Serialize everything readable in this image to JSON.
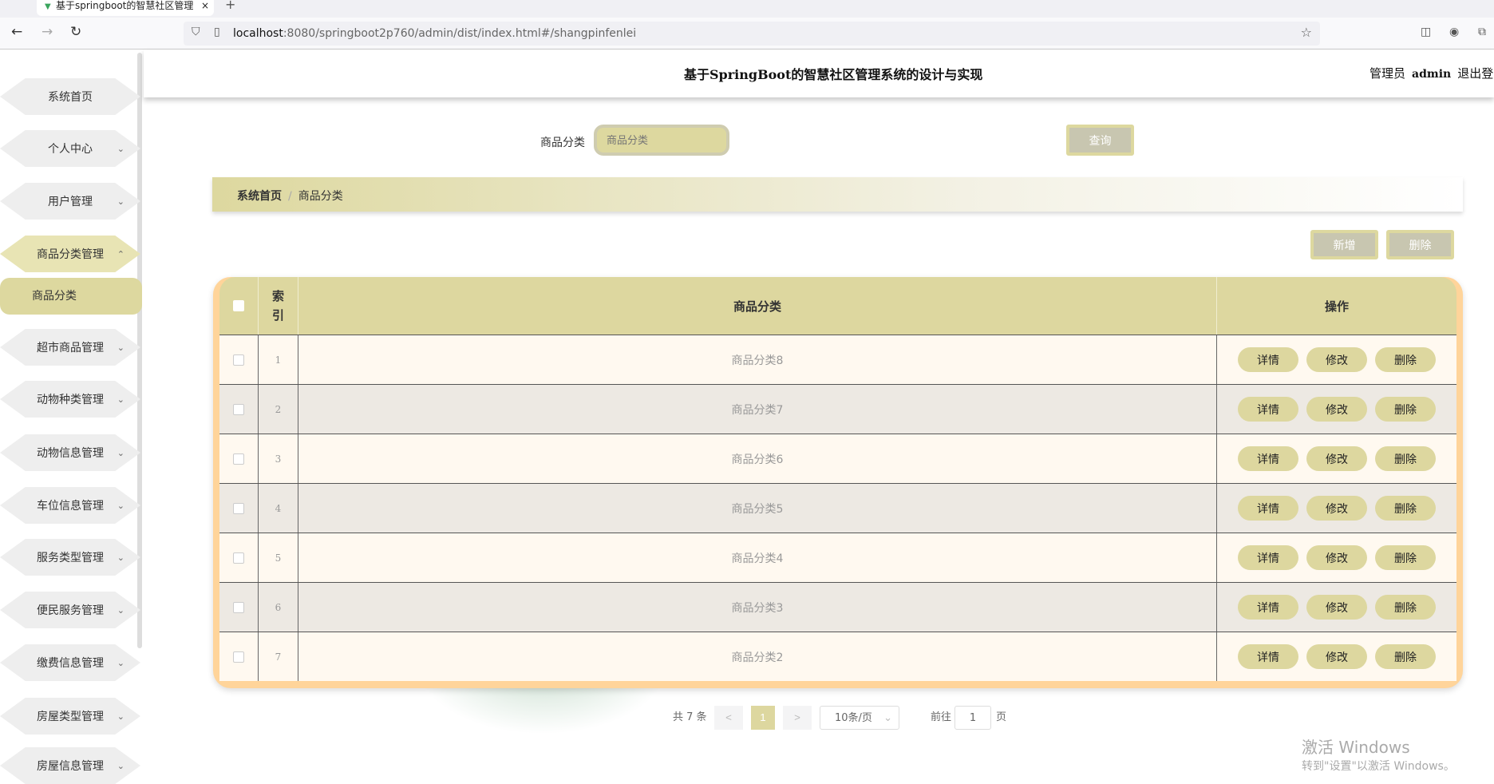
{
  "browser": {
    "tab_title": "基于springboot的智慧社区管理",
    "url_host": "localhost",
    "url_rest": ":8080/springboot2p760/admin/dist/index.html#/shangpinfenlei"
  },
  "header": {
    "title": "基于SpringBoot的智慧社区管理系统的设计与实现",
    "role": "管理员",
    "username": "admin",
    "logout": "退出登"
  },
  "sidebar": {
    "items": [
      {
        "label": "系统首页",
        "chev": ""
      },
      {
        "label": "个人中心",
        "chev": "⌄"
      },
      {
        "label": "用户管理",
        "chev": "⌄"
      },
      {
        "label": "商品分类管理",
        "chev": "⌃",
        "active": true
      },
      {
        "label": "超市商品管理",
        "chev": "⌄"
      },
      {
        "label": "动物种类管理",
        "chev": "⌄"
      },
      {
        "label": "动物信息管理",
        "chev": "⌄"
      },
      {
        "label": "车位信息管理",
        "chev": "⌄"
      },
      {
        "label": "服务类型管理",
        "chev": "⌄"
      },
      {
        "label": "便民服务管理",
        "chev": "⌄"
      },
      {
        "label": "缴费信息管理",
        "chev": "⌄"
      },
      {
        "label": "房屋类型管理",
        "chev": "⌄"
      },
      {
        "label": "房屋信息管理",
        "chev": "⌄"
      }
    ],
    "sub_item": "商品分类"
  },
  "search": {
    "label": "商品分类",
    "placeholder": "商品分类",
    "query": "查询"
  },
  "breadcrumb": {
    "home": "系统首页",
    "sep": "/",
    "current": "商品分类"
  },
  "actions": {
    "add": "新增",
    "delete": "删除"
  },
  "table": {
    "headers": [
      "",
      "索\n引",
      "商品分类",
      "操作"
    ],
    "rows": [
      {
        "index": "1",
        "name": "商品分类8"
      },
      {
        "index": "2",
        "name": "商品分类7"
      },
      {
        "index": "3",
        "name": "商品分类6"
      },
      {
        "index": "4",
        "name": "商品分类5"
      },
      {
        "index": "5",
        "name": "商品分类4"
      },
      {
        "index": "6",
        "name": "商品分类3"
      },
      {
        "index": "7",
        "name": "商品分类2"
      }
    ],
    "ops": [
      "详情",
      "修改",
      "删除"
    ]
  },
  "pagination": {
    "total": "共 7 条",
    "prev": "<",
    "page": "1",
    "next": ">",
    "size": "10条/页",
    "goto": "前往",
    "goto_value": "1",
    "page_suffix": "页"
  },
  "watermark": {
    "line1": "激活 Windows",
    "line2": "转到\"设置\"以激活 Windows。"
  }
}
